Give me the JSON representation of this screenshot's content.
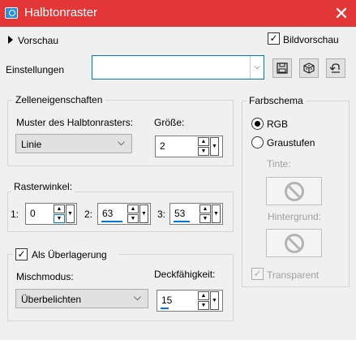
{
  "window": {
    "title": "Halbtonraster",
    "close_glyph": "✕"
  },
  "preview": {
    "label": "Vorschau",
    "image_preview_label": "Bildvorschau",
    "image_preview_checked": true
  },
  "settings": {
    "label": "Einstellungen",
    "value": ""
  },
  "cell_props": {
    "title": "Zelleneigenschaften",
    "pattern_label": "Muster des Halbtonrasters:",
    "pattern_value": "Linie",
    "size_label": "Größe:",
    "size_value": "2"
  },
  "raster": {
    "title": "Rasterwinkel:",
    "angle1_label": "1:",
    "angle1_value": "0",
    "angle2_label": "2:",
    "angle2_value": "63",
    "angle3_label": "3:",
    "angle3_value": "53"
  },
  "overlay": {
    "label": "Als Überlagerung",
    "checked": true,
    "blend_label": "Mischmodus:",
    "blend_value": "Überbelichten",
    "opacity_label": "Deckfähigkeit:",
    "opacity_value": "15"
  },
  "scheme": {
    "title": "Farbschema",
    "rgb_label": "RGB",
    "gray_label": "Graustufen",
    "selected": "RGB",
    "tint_label": "Tinte:",
    "background_label": "Hintergrund:",
    "transparent_label": "Transparent",
    "transparent_checked": true
  },
  "glyphs": {
    "check": "✓",
    "up": "▲",
    "down": "▼",
    "chevron": "⌵"
  },
  "colors": {
    "titlebar": "#e33636",
    "accent": "#0078d7"
  }
}
